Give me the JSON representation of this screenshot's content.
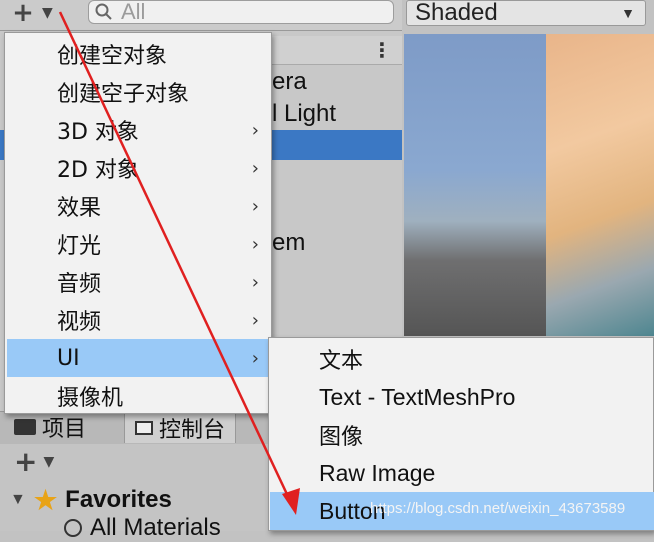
{
  "toolbar": {
    "add_symbol": "+",
    "search_placeholder": "All",
    "scene_mode": "Shaded"
  },
  "hierarchy": {
    "rows": [
      "era",
      "l Light",
      "em"
    ]
  },
  "context_menu": {
    "items": [
      {
        "label": "创建空对象",
        "submenu": false
      },
      {
        "label": "创建空子对象",
        "submenu": false
      },
      {
        "label": "3D 对象",
        "submenu": true
      },
      {
        "label": "2D 对象",
        "submenu": true
      },
      {
        "label": "效果",
        "submenu": true
      },
      {
        "label": "灯光",
        "submenu": true
      },
      {
        "label": "音频",
        "submenu": true
      },
      {
        "label": "视频",
        "submenu": true
      },
      {
        "label": "UI",
        "submenu": true,
        "highlighted": true
      },
      {
        "label": "摄像机",
        "submenu": false
      }
    ],
    "arrow": "›"
  },
  "ui_submenu": {
    "items": [
      {
        "label": "文本"
      },
      {
        "label": "Text - TextMeshPro"
      },
      {
        "label": "图像"
      },
      {
        "label": "Raw Image"
      },
      {
        "label": "Button",
        "highlighted": true
      }
    ]
  },
  "project_panel": {
    "tabs": [
      "项目",
      "控制台"
    ],
    "favorites_label": "Favorites",
    "first_favorite": "All Materials"
  },
  "watermark": "https://blog.csdn.net/weixin_43673589",
  "colors": {
    "menu_highlight": "#99c9f7",
    "selection_blue": "#3b78c4",
    "annotation_arrow": "#e02020",
    "favorite_star": "#e8a317"
  }
}
